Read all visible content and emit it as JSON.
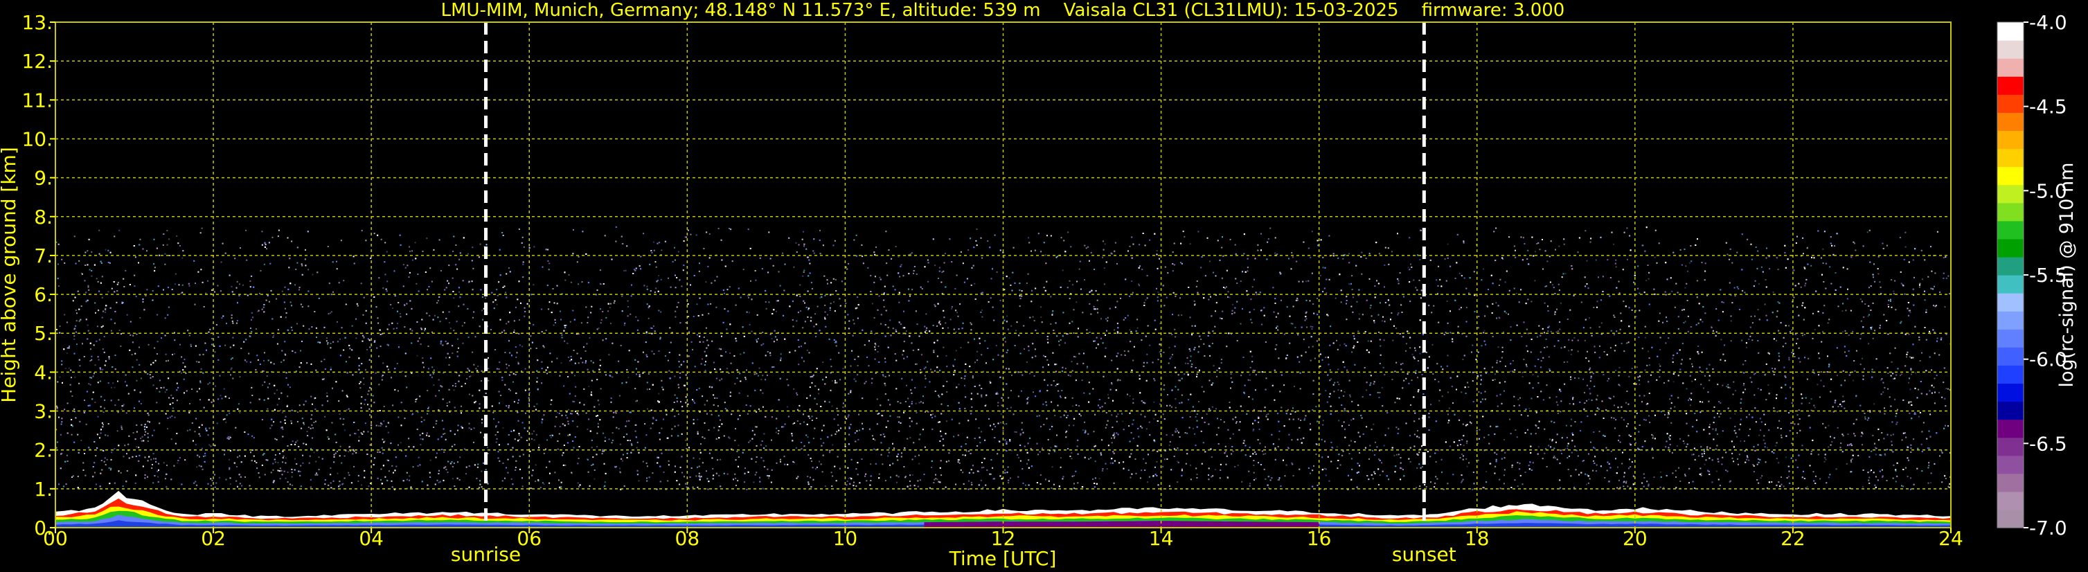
{
  "colors": {
    "background": "#000000",
    "text": "#ffff00",
    "grid": "#c8c800",
    "marker_line": "#ffffff",
    "colorbar_label": "#ffffff"
  },
  "chart_data": {
    "type": "heatmap",
    "title": "LMU-MIM, Munich, Germany; 48.148° N 11.573° E, altitude: 539 m    Vaisala CL31 (CL31LMU): 15-03-2025    firmware: 3.000",
    "xlabel": "Time [UTC]",
    "ylabel": "Height above ground [km]",
    "xlim": [
      0,
      24
    ],
    "ylim": [
      0,
      13
    ],
    "x_ticks": [
      0,
      2,
      4,
      6,
      8,
      10,
      12,
      14,
      16,
      18,
      20,
      22,
      24
    ],
    "x_tick_labels": [
      "00",
      "02",
      "04",
      "06",
      "08",
      "10",
      "12",
      "14",
      "16",
      "18",
      "20",
      "22",
      "24"
    ],
    "y_ticks": [
      0,
      1,
      2,
      3,
      4,
      5,
      6,
      7,
      8,
      9,
      10,
      11,
      12,
      13
    ],
    "y_tick_labels": [
      "0.",
      "1.",
      "2.",
      "3.",
      "4.",
      "5.",
      "6.",
      "7.",
      "8.",
      "9.",
      "10.",
      "11.",
      "12.",
      "13."
    ],
    "grid": true,
    "signal_top_km": 7.75,
    "events": [
      {
        "label": "sunrise",
        "x": 5.45
      },
      {
        "label": "sunset",
        "x": 17.33
      }
    ],
    "colorbar": {
      "label": "log(rc-signal) @ 910 nm",
      "range": [
        -7.0,
        -4.0
      ],
      "tick_values": [
        -4.0,
        -4.5,
        -5.0,
        -5.5,
        -6.0,
        -6.5,
        -7.0
      ],
      "tick_labels": [
        "-4.0",
        "-4.5",
        "-5.0",
        "-5.5",
        "-6.0",
        "-6.5",
        "-7.0"
      ],
      "colors": [
        "#a890a8",
        "#b090b0",
        "#a070a0",
        "#9050a0",
        "#803090",
        "#700080",
        "#0000a0",
        "#0010e0",
        "#2040ff",
        "#4060ff",
        "#6080ff",
        "#80a0ff",
        "#a0c0ff",
        "#40c0c0",
        "#20a080",
        "#00a000",
        "#20c020",
        "#80e020",
        "#c0f020",
        "#ffff00",
        "#ffd000",
        "#ffb000",
        "#ff8000",
        "#ff4000",
        "#ff0000",
        "#f0b0b0",
        "#e8d8d8",
        "#ffffff"
      ]
    },
    "boundary_layer_km": [
      [
        0.0,
        0.4
      ],
      [
        0.5,
        0.5
      ],
      [
        0.8,
        0.9
      ],
      [
        1.2,
        0.6
      ],
      [
        1.6,
        0.35
      ],
      [
        2.2,
        0.35
      ],
      [
        2.5,
        0.3
      ],
      [
        3.0,
        0.3
      ],
      [
        4.0,
        0.35
      ],
      [
        5.0,
        0.4
      ],
      [
        6.0,
        0.35
      ],
      [
        7.0,
        0.3
      ],
      [
        8.0,
        0.3
      ],
      [
        9.0,
        0.35
      ],
      [
        10.0,
        0.35
      ],
      [
        11.0,
        0.4
      ],
      [
        12.0,
        0.45
      ],
      [
        13.0,
        0.45
      ],
      [
        14.0,
        0.5
      ],
      [
        15.0,
        0.45
      ],
      [
        16.0,
        0.4
      ],
      [
        17.0,
        0.3
      ],
      [
        17.5,
        0.35
      ],
      [
        18.0,
        0.5
      ],
      [
        18.5,
        0.6
      ],
      [
        19.0,
        0.55
      ],
      [
        19.5,
        0.45
      ],
      [
        20.0,
        0.5
      ],
      [
        21.0,
        0.4
      ],
      [
        22.0,
        0.35
      ],
      [
        23.0,
        0.35
      ],
      [
        24.0,
        0.3
      ]
    ]
  }
}
